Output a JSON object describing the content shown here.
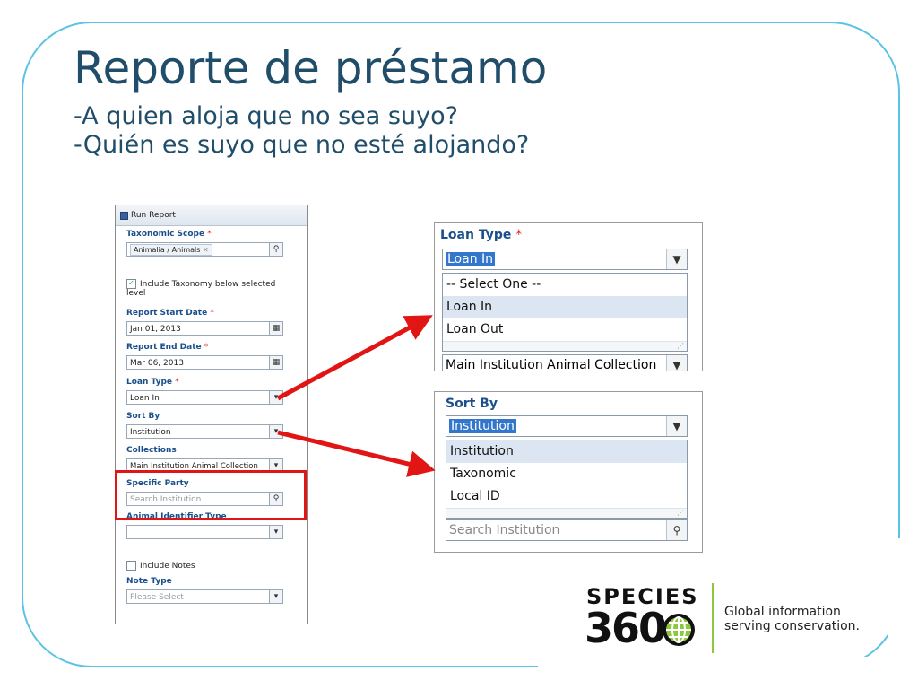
{
  "slide": {
    "title": "Reporte de préstamo",
    "line1": "-A quien aloja que no sea suyo?",
    "line2": "-Quién es suyo que no esté alojando?"
  },
  "panel": {
    "header": "Run Report",
    "taxonomic_scope_label": "Taxonomic Scope",
    "taxonomic_scope_value": "Animalia / Animals",
    "include_taxonomy_label": "Include Taxonomy below selected level",
    "start_date_label": "Report Start Date",
    "start_date_value": "Jan 01, 2013",
    "end_date_label": "Report End Date",
    "end_date_value": "Mar 06, 2013",
    "loan_type_label": "Loan Type",
    "loan_type_value": "Loan In",
    "sort_by_label": "Sort By",
    "sort_by_value": "Institution",
    "collections_label": "Collections",
    "collections_value": "Main Institution Animal Collection",
    "specific_party_label": "Specific Party",
    "specific_party_placeholder": "Search Institution",
    "animal_id_type_label": "Animal Identifier Type",
    "include_notes_label": "Include Notes",
    "note_type_label": "Note Type",
    "note_type_placeholder": "Please Select",
    "required_mark": "*"
  },
  "loan_type_dropdown": {
    "label": "Loan Type",
    "selected": "Loan In",
    "options": [
      "-- Select One --",
      "Loan In",
      "Loan Out"
    ],
    "below_value": "Main Institution Animal Collection"
  },
  "sort_by_dropdown": {
    "label": "Sort By",
    "selected": "Institution",
    "options": [
      "Institution",
      "Taxonomic",
      "Local ID"
    ],
    "below_placeholder": "Search Institution"
  },
  "logo": {
    "word": "SPECIES",
    "number": "360",
    "tagline_1": "Global information",
    "tagline_2": "serving conservation."
  },
  "colors": {
    "title": "#1f4d6a",
    "frame": "#5bc3e3",
    "highlight": "#e21515",
    "label_blue": "#1b4f8a",
    "logo_accent": "#8dc63f"
  }
}
